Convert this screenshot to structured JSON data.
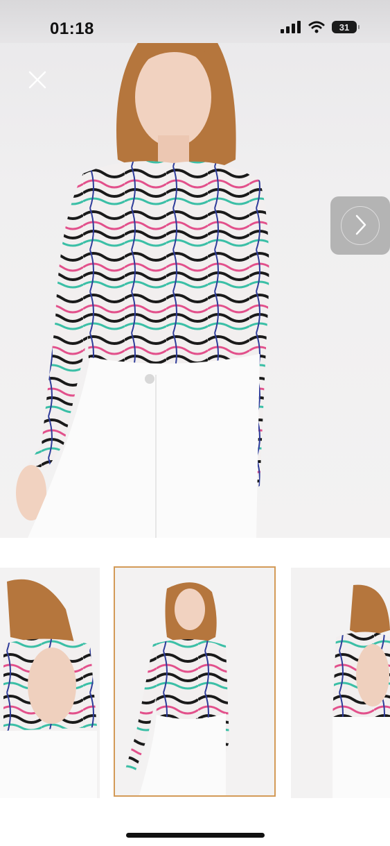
{
  "status_bar": {
    "time": "01:18",
    "battery": "31",
    "icons": [
      "cellular-signal-icon",
      "wifi-icon",
      "battery-icon"
    ]
  },
  "viewer": {
    "close_icon": "close-icon",
    "next_icon": "chevron-right-icon",
    "accent_color": "#d39a57"
  },
  "thumbnails": [
    {
      "view": "back",
      "selected": false
    },
    {
      "view": "front",
      "selected": true
    },
    {
      "view": "back",
      "selected": false
    }
  ]
}
